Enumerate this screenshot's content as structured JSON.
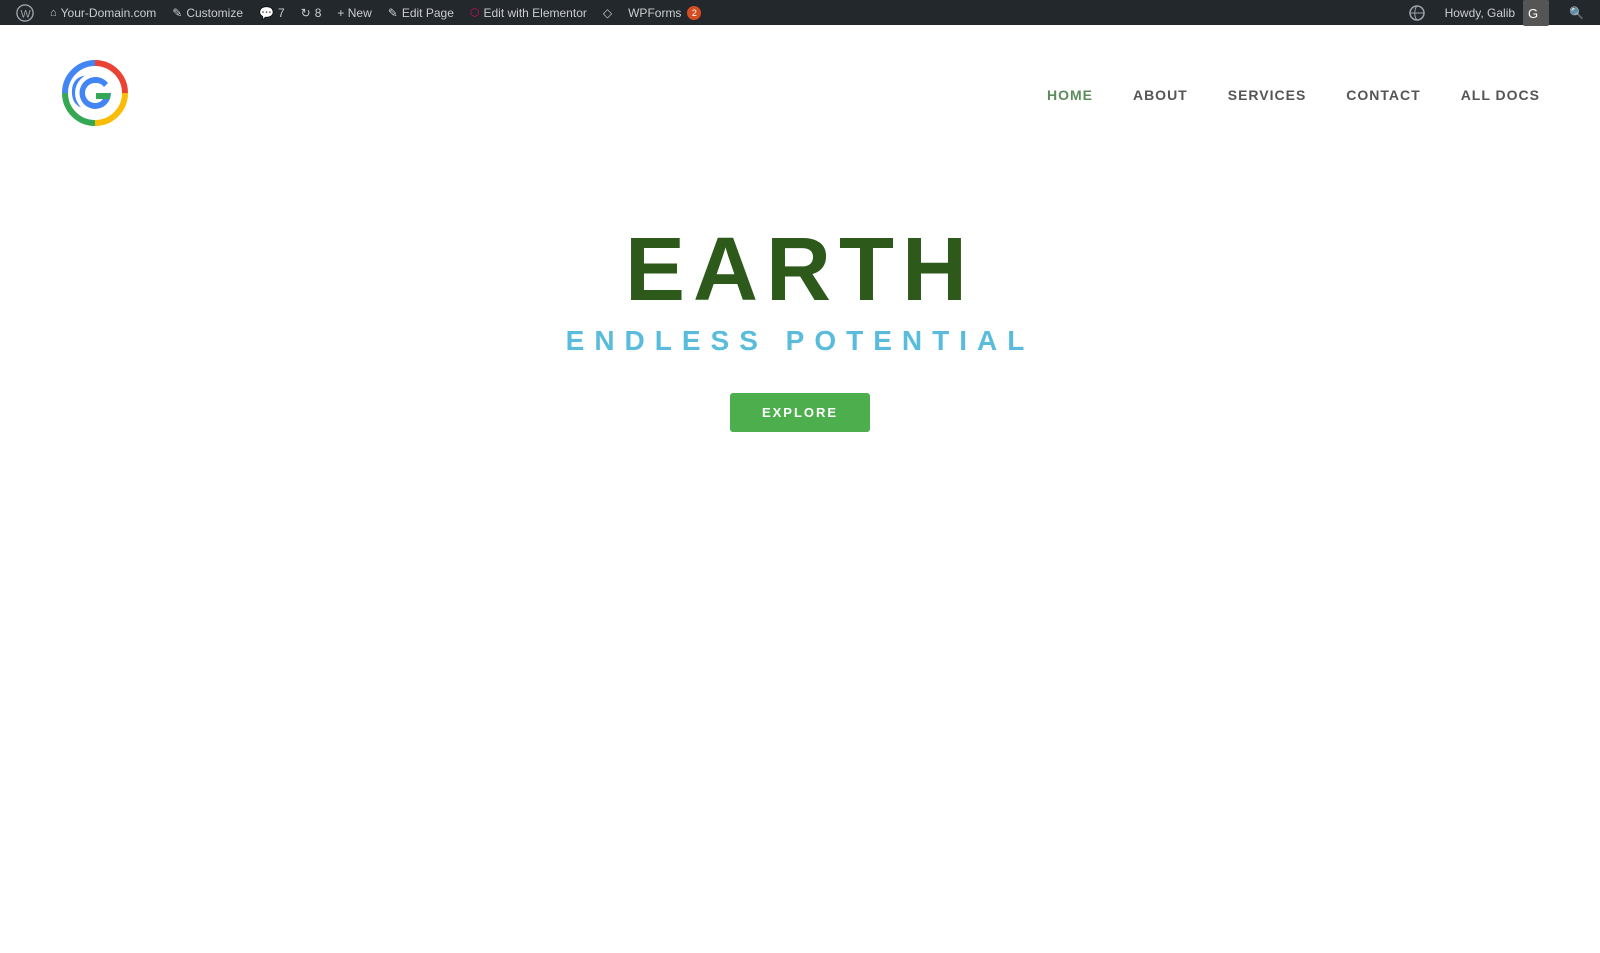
{
  "adminbar": {
    "wp_icon": "⊞",
    "site_name": "Your-Domain.com",
    "customize_label": "Customize",
    "comments_count": "7",
    "updates_count": "8",
    "new_label": "+ New",
    "edit_page_label": "Edit Page",
    "elementor_label": "Edit with Elementor",
    "diamond_icon": "◇",
    "wpforms_label": "WPForms",
    "wpforms_badge": "2",
    "howdy_label": "Howdy, Galib",
    "search_icon": "🔍"
  },
  "nav": {
    "home": "HOME",
    "about": "ABOUT",
    "services": "SERVICES",
    "contact": "CONTACT",
    "all_docs": "ALL DOCS"
  },
  "hero": {
    "title": "EARTH",
    "subtitle": "ENDLESS POTENTIAL",
    "explore_button": "EXPLORE"
  },
  "colors": {
    "admin_bar_bg": "#23282d",
    "nav_active": "#5b8c5a",
    "hero_title": "#2d5a1b",
    "hero_subtitle": "#5abcdc",
    "explore_btn": "#4cae4c"
  }
}
